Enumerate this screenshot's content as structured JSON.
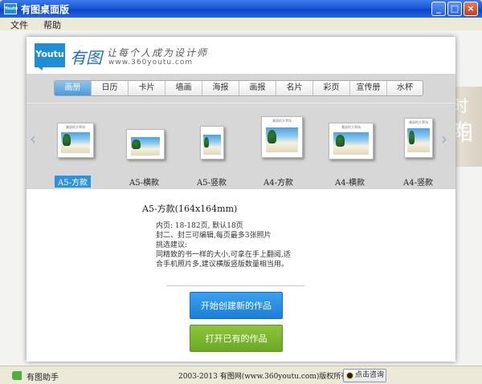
{
  "window": {
    "title": "有图桌面版",
    "icon_text": "Youtu",
    "minimize": "_",
    "maximize": "□",
    "close": "×"
  },
  "menu": [
    "文件",
    "帮助"
  ],
  "brand": {
    "logo_text": "Youtu",
    "name": "有图",
    "slogan": "让每个人成为设计师",
    "url": "www.360youtu.com"
  },
  "tabs": [
    {
      "label": "画册",
      "active": true
    },
    {
      "label": "日历"
    },
    {
      "label": "卡片"
    },
    {
      "label": "墙画"
    },
    {
      "label": "海报"
    },
    {
      "label": "画报"
    },
    {
      "label": "名片"
    },
    {
      "label": "彩页"
    },
    {
      "label": "宣传册"
    },
    {
      "label": "水杯"
    }
  ],
  "gallery": {
    "left_arrow": "‹",
    "right_arrow": "›",
    "cover_title": "美丽的大草场",
    "products": [
      {
        "label": "A5-方款",
        "selected": true
      },
      {
        "label": "A5-横款"
      },
      {
        "label": "A5-竖款"
      },
      {
        "label": "A4-方款"
      },
      {
        "label": "A4-横款"
      },
      {
        "label": "A4-竖款"
      }
    ]
  },
  "background_text": [
    "时光",
    "阳"
  ],
  "detail": {
    "title": "A5-方款(164x164mm)",
    "lines": [
      "内页: 18-182页, 默认18页",
      "封二、封三可编辑,每页最多3张照片",
      "挑选建议:",
      "同精致的书一样的大小,可拿在手上翻阅,适",
      "合手机照片多,建议横版竖版数量相当用。"
    ]
  },
  "actions": {
    "create": "开始创建新的作品",
    "open": "打开已有的作品"
  },
  "status": {
    "helper": "有图助手",
    "copyright": "2003-2013 有图网(www.360youtu.com)版权所有",
    "consult": "点击咨询"
  }
}
